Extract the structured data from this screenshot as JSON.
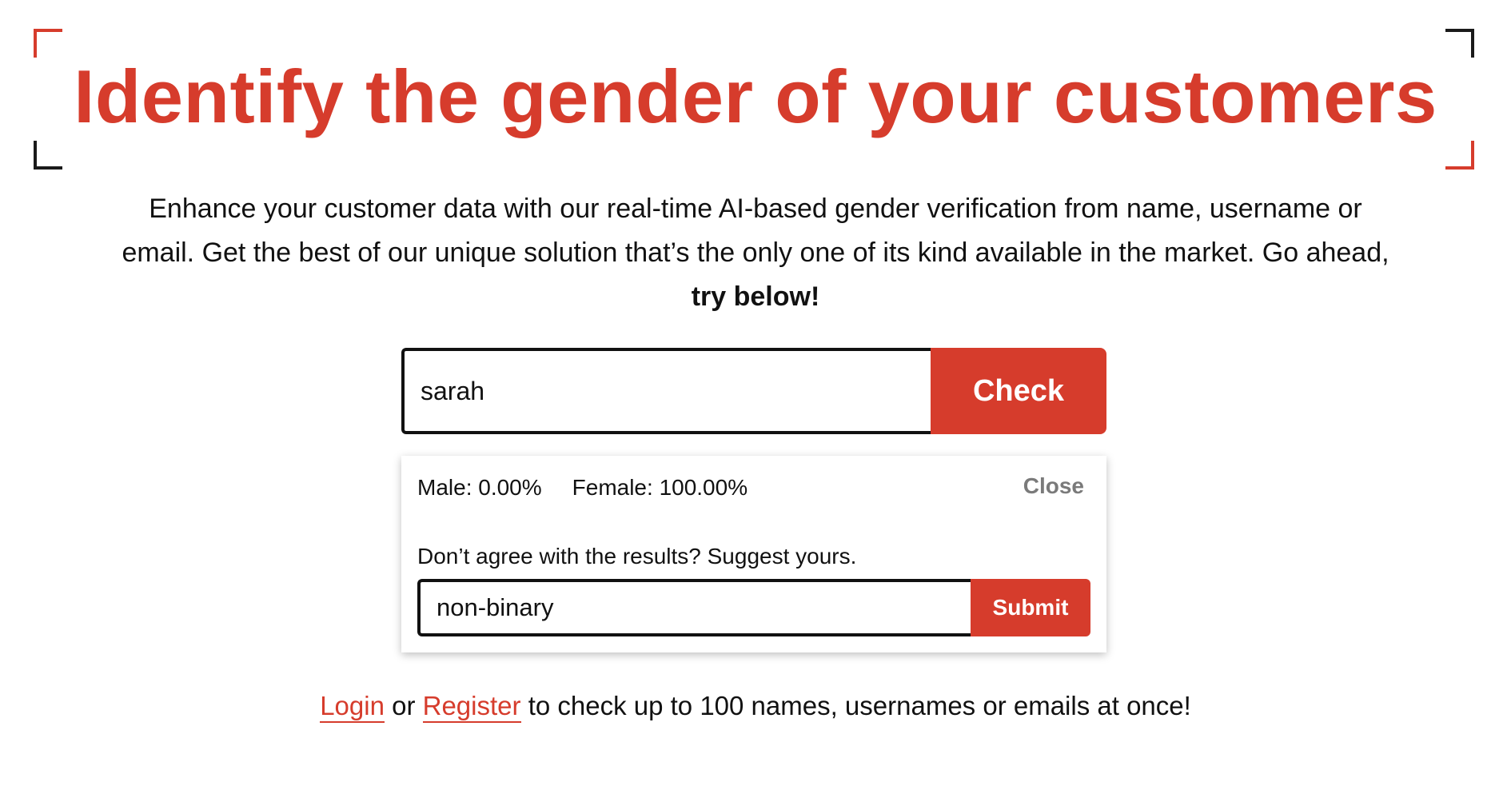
{
  "hero": {
    "title": "Identify the gender of your customers",
    "description_main": "Enhance your customer data with our real-time AI-based gender verification from name, username or email. Get the best of our unique solution that’s the only one of its kind available in the market. Go ahead,",
    "description_emphasis": "try below!"
  },
  "check_form": {
    "input_value": "sarah",
    "button_label": "Check"
  },
  "result": {
    "male_text": "Male: 0.00%",
    "female_text": "Female: 100.00%",
    "close_label": "Close",
    "suggest_prompt": "Don’t agree with the results? Suggest yours.",
    "suggest_value": "non-binary",
    "submit_label": "Submit"
  },
  "footer": {
    "login_label": "Login",
    "or_text": "or",
    "register_label": "Register",
    "tail_text": "to check up to 100 names, usernames or emails at once!"
  },
  "colors": {
    "accent": "#d63c2c",
    "text": "#111111",
    "muted": "#7a7a7a"
  }
}
